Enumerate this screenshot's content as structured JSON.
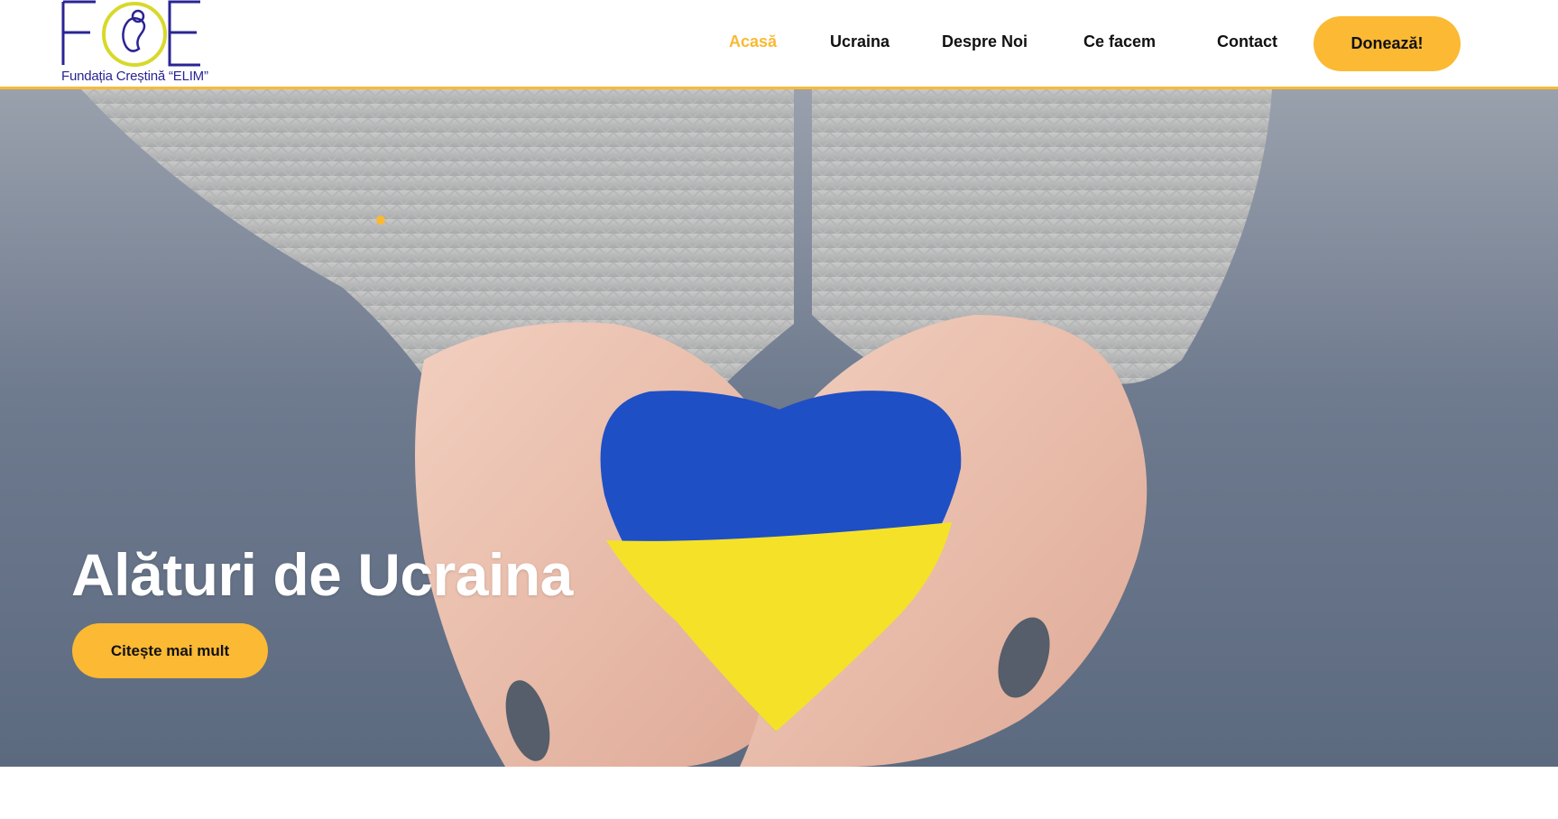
{
  "brand": {
    "logo_letters": "FCE",
    "subtitle": "Fundația Creștină “ELIM”",
    "primary_color": "#2a2493",
    "accent_color": "#f9b934",
    "logo_ring_color": "#d7d92b"
  },
  "nav": {
    "items": [
      {
        "label": "Acasă",
        "active": true
      },
      {
        "label": "Ucraina",
        "active": false
      },
      {
        "label": "Despre Noi",
        "active": false
      },
      {
        "label": "Ce facem",
        "active": false
      },
      {
        "label": "Contact",
        "active": false
      }
    ],
    "donate_label": "Donează!"
  },
  "hero": {
    "title": "Alături de Ucraina",
    "cta_label": "Citește mai mult",
    "heart_colors": {
      "top": "#1f4fc4",
      "bottom": "#f5e228"
    }
  }
}
